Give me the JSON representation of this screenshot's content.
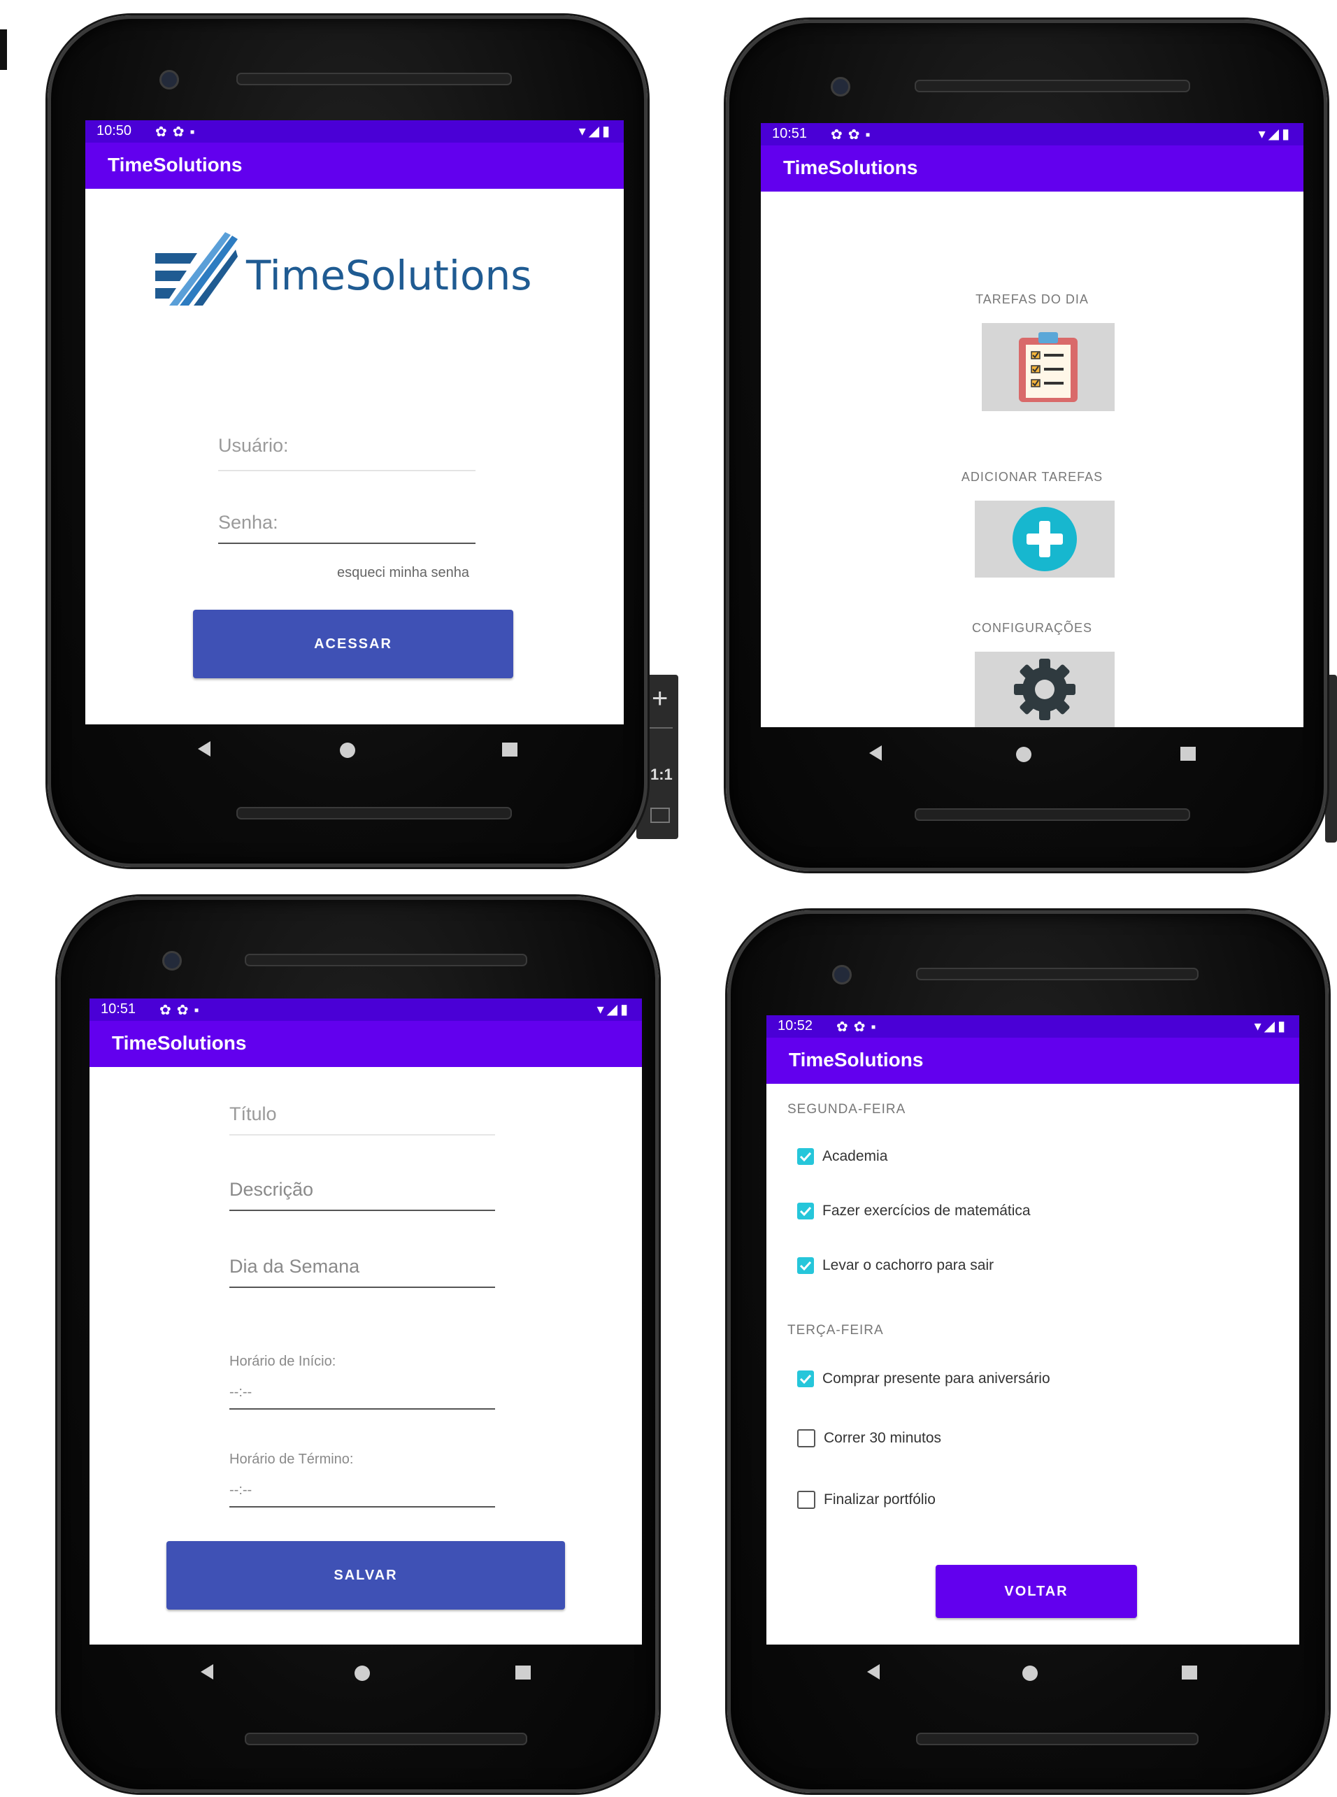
{
  "app": {
    "name": "TimeSolutions",
    "logo_text": "TimeSolutions"
  },
  "colors": {
    "status": "#4a00d6",
    "appbar": "#6200ee",
    "primary_button": "#3f51b5",
    "accent_check": "#26c6da",
    "add_circle": "#17b7cf"
  },
  "emulator": {
    "ratio_label": "1:1"
  },
  "screens": {
    "login": {
      "time": "10:50",
      "username_placeholder": "Usuário:",
      "password_placeholder": "Senha:",
      "forgot_link": "esqueci minha senha",
      "submit_label": "ACESSAR"
    },
    "menu": {
      "time": "10:51",
      "items": [
        {
          "label": "TAREFAS DO DIA",
          "icon": "clipboard-checklist-icon"
        },
        {
          "label": "ADICIONAR TAREFAS",
          "icon": "plus-circle-icon"
        },
        {
          "label": "CONFIGURAÇÕES",
          "icon": "gear-icon"
        }
      ]
    },
    "add_task": {
      "time": "10:51",
      "title_placeholder": "Título",
      "description_placeholder": "Descrição",
      "weekday_placeholder": "Dia da Semana",
      "start_label": "Horário de Início:",
      "start_value": "--:--",
      "end_label": "Horário de Término:",
      "end_value": "--:--",
      "save_label": "SALVAR"
    },
    "task_list": {
      "time": "10:52",
      "sections": [
        {
          "title": "SEGUNDA-FEIRA",
          "tasks": [
            {
              "text": "Academia",
              "checked": true
            },
            {
              "text": "Fazer exercícios de matemática",
              "checked": true
            },
            {
              "text": "Levar o cachorro para sair",
              "checked": true
            }
          ]
        },
        {
          "title": "TERÇA-FEIRA",
          "tasks": [
            {
              "text": "Comprar presente para aniversário",
              "checked": true
            },
            {
              "text": "Correr 30 minutos",
              "checked": false
            },
            {
              "text": "Finalizar portfólio",
              "checked": false
            }
          ]
        }
      ],
      "back_label": "VOLTAR"
    }
  }
}
